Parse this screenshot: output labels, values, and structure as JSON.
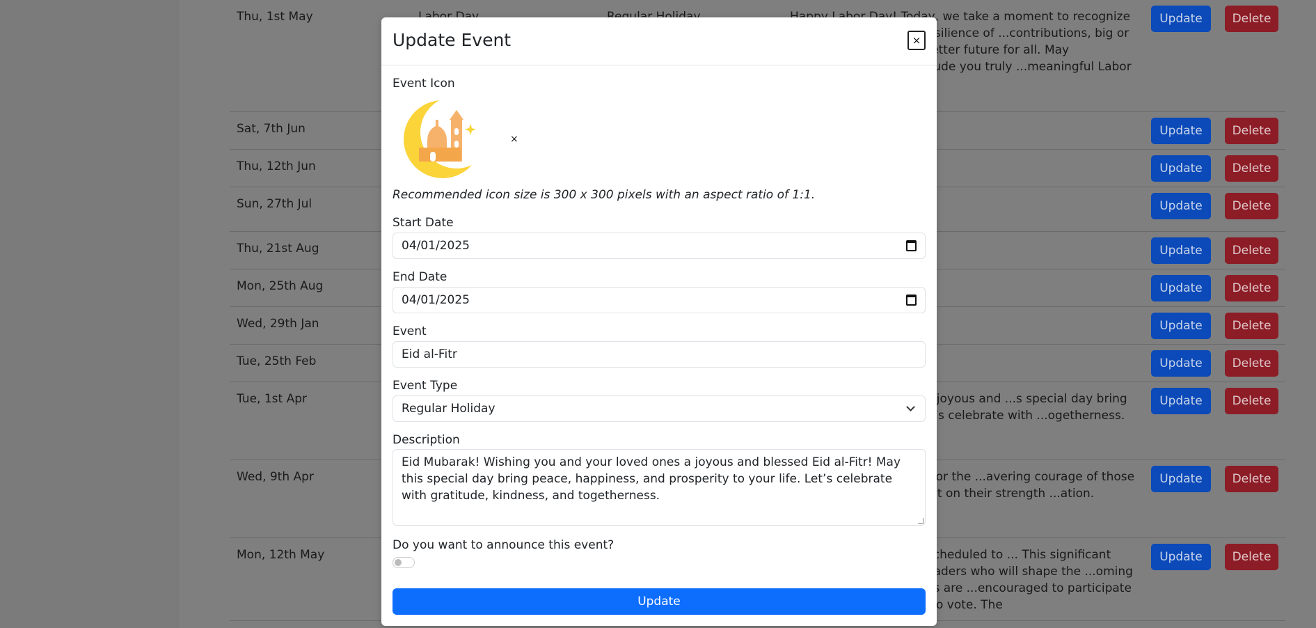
{
  "background": {
    "rows": [
      {
        "date": "Thu, 1st May",
        "name": "Labor Day",
        "type": "Regular Holiday",
        "desc": "Happy Labor Day! Today, we take a moment to recognize and ...dedication, and resilience of ...contributions, big or small, help ...es and a better future for all. May ...recognition, and gratitude you truly ...meaningful Labor Day!",
        "h": 162
      },
      {
        "date": "Sat, 7th Jun",
        "name": "",
        "type": "",
        "desc": "",
        "h": 55
      },
      {
        "date": "Thu, 12th Jun",
        "name": "",
        "type": "",
        "desc": "",
        "h": 55
      },
      {
        "date": "Sun, 27th Jul",
        "name": "",
        "type": "",
        "desc": "",
        "h": 65
      },
      {
        "date": "Thu, 21st Aug",
        "name": "",
        "type": "",
        "desc": "",
        "h": 55
      },
      {
        "date": "Mon, 25th Aug",
        "name": "",
        "type": "",
        "desc": "",
        "h": 55
      },
      {
        "date": "Wed, 29th Jan",
        "name": "",
        "type": "",
        "desc": "",
        "h": 55
      },
      {
        "date": "Tue, 25th Feb",
        "name": "",
        "type": "",
        "desc": "",
        "h": 55
      },
      {
        "date": "Tue, 1st Apr",
        "name": "",
        "type": "",
        "desc": "...and your loved ones a joyous and ...s special day bring peace, ...to your life. Let’s celebrate with ...ogetherness.",
        "h": 113
      },
      {
        "date": "Wed, 9th Apr",
        "name": "",
        "type": "",
        "desc": "...we remember and honor the ...avering courage of those who ...stice. Let us reflect on their strength ...ation.",
        "h": 113
      },
      {
        "date": "Mon, 12th May",
        "name": "",
        "type": "",
        "desc": "...d Local Elections are scheduled to ... This significant national event ...elect leaders who will shape the ...oming years. All eligible citizens are ...encouraged to participate and exercise their right to vote. The",
        "h": 120
      }
    ],
    "update_label": "Update",
    "delete_label": "Delete"
  },
  "modal": {
    "title": "Update Event",
    "close_label": "×",
    "icon_label": "Event Icon",
    "icon_remove": "×",
    "icon_hint": "Recommended icon size is 300 x 300 pixels with an aspect ratio of 1:1.",
    "start_date_label": "Start Date",
    "start_date_value": "04/01/2025",
    "end_date_label": "End Date",
    "end_date_value": "04/01/2025",
    "event_label": "Event",
    "event_value": "Eid al-Fitr",
    "event_type_label": "Event Type",
    "event_type_value": "Regular Holiday",
    "description_label": "Description",
    "description_value": "Eid Mubarak! Wishing you and your loved ones a joyous and blessed Eid al-Fitr! May this special day bring peace, happiness, and prosperity to your life. Let’s celebrate with gratitude, kindness, and togetherness.",
    "announce_label": "Do you want to announce this event?",
    "announce_on": false,
    "submit_label": "Update"
  },
  "colors": {
    "primary": "#0d6efd",
    "danger": "#dc3545",
    "overlay": "#808080"
  }
}
